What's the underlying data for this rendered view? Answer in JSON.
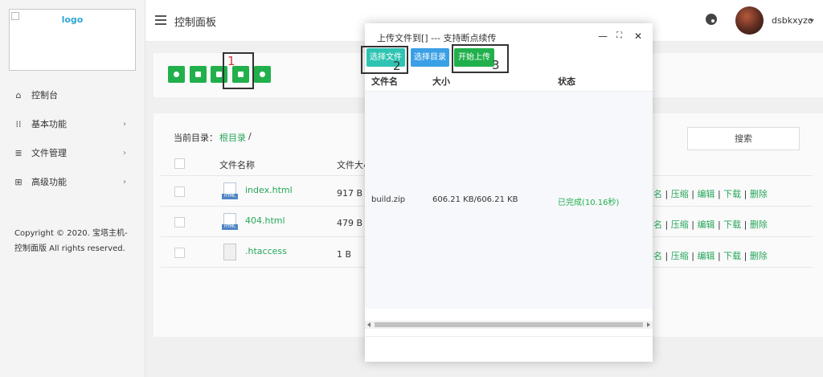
{
  "sidebar": {
    "logo_alt": "logo",
    "items": [
      {
        "label": "控制台",
        "icon": "home-icon"
      },
      {
        "label": "基本功能",
        "icon": "grid-icon"
      },
      {
        "label": "文件管理",
        "icon": "list-icon"
      },
      {
        "label": "高级功能",
        "icon": "plus-square-icon"
      }
    ],
    "copyright": "Copyright © 2020. 宝塔主机-控制面版 All rights reserved."
  },
  "header": {
    "title": "控制面板",
    "username": "dsbkxyzc"
  },
  "toolbar": {
    "buttons": [
      "add-icon",
      "folder-icon",
      "file-icon",
      "upload-icon",
      "history-icon"
    ]
  },
  "files": {
    "breadcrumb_label": "当前目录：",
    "breadcrumb_root": "根目录",
    "breadcrumb_sep": "/",
    "search_label": "搜索",
    "columns": [
      "文件名称",
      "文件大小"
    ],
    "rows": [
      {
        "name": "index.html",
        "size": "917 B",
        "icon_tag": "HTML"
      },
      {
        "name": "404.html",
        "size": "479 B",
        "icon_tag": "HTML"
      },
      {
        "name": ".htaccess",
        "size": "1 B",
        "icon_tag": ""
      }
    ],
    "ops": {
      "first_partial": "名",
      "sep": "|",
      "compress": "压缩",
      "edit": "编辑",
      "download": "下载",
      "delete": "删除"
    }
  },
  "upload_dialog": {
    "title": "上传文件到[] --- 支持断点续传",
    "buttons": {
      "select_file": "选择文件",
      "select_dir": "选择目录",
      "start": "开始上传"
    },
    "columns": {
      "name": "文件名",
      "size": "大小",
      "status": "状态"
    },
    "rows": [
      {
        "name": "build.zip",
        "size": "606.21 KB/606.21 KB",
        "status": "已完成(10.16秒)"
      }
    ],
    "win_controls": {
      "minimize": "—",
      "maximize": "⛶",
      "close": "✕"
    }
  },
  "annotations": [
    "1",
    "2",
    "3"
  ],
  "colors": {
    "accent_green": "#21b04c",
    "link_green": "#26a65b",
    "teal": "#2fc4b2",
    "blue": "#3aa0e6"
  }
}
